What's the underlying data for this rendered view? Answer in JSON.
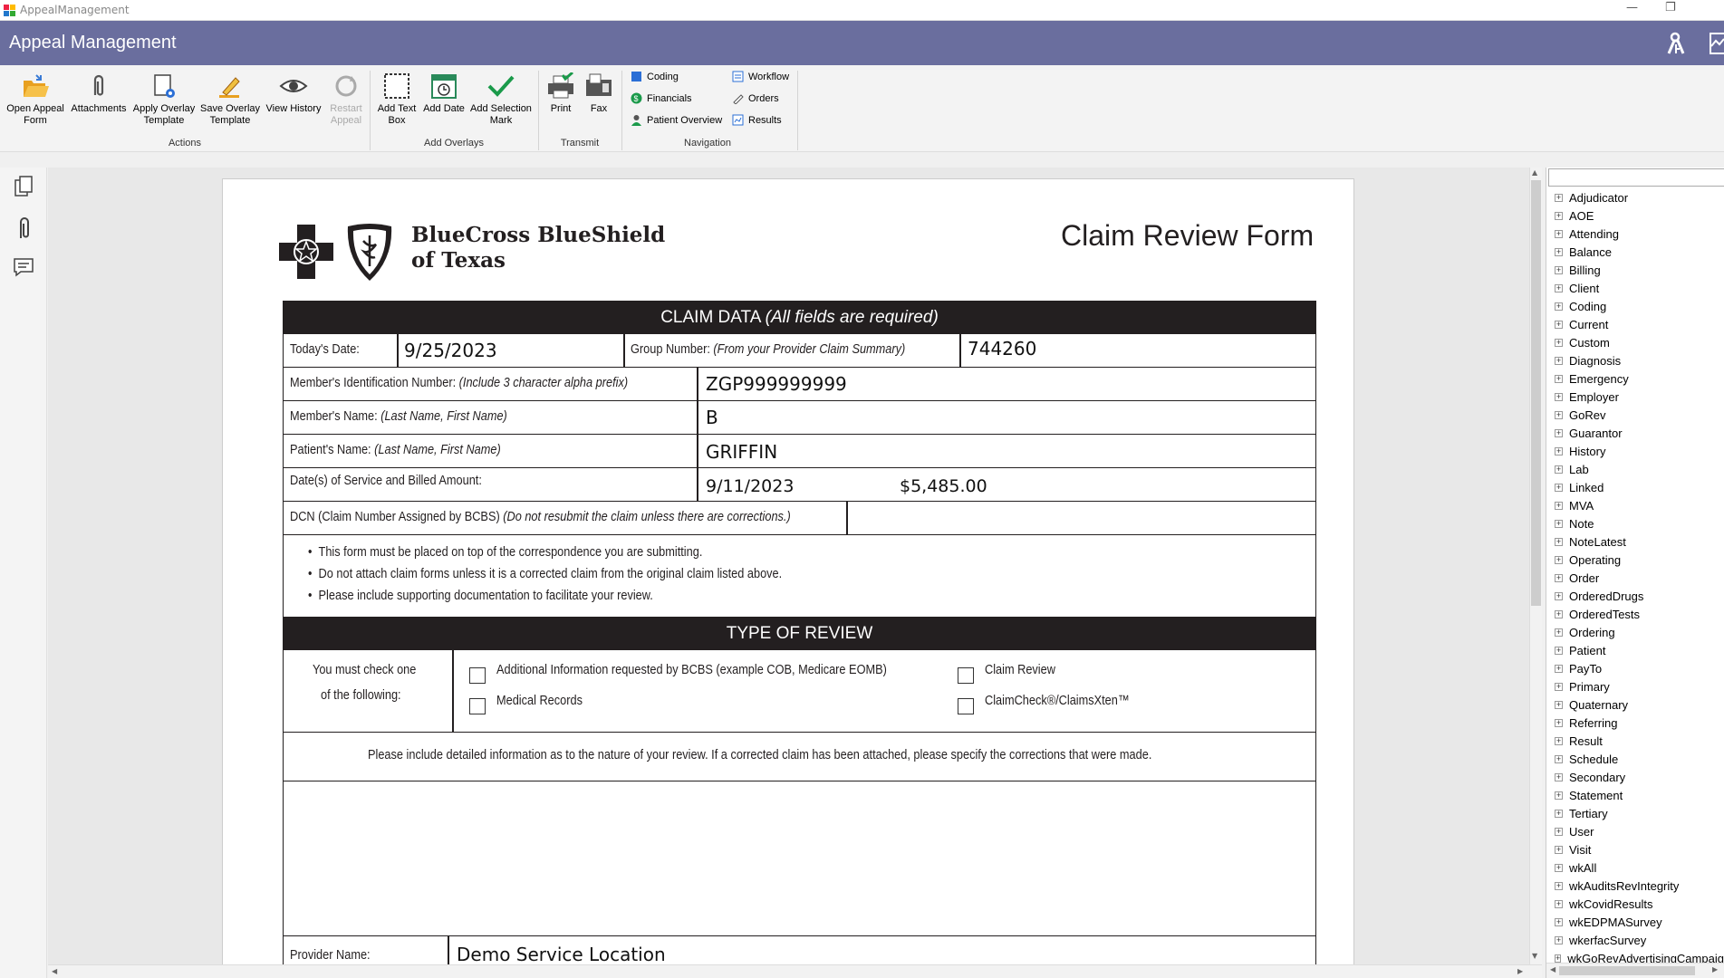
{
  "window": {
    "title": "AppealManagement"
  },
  "header": {
    "title": "Appeal Management"
  },
  "ribbon": {
    "actions": [
      {
        "label1": "Open Appeal",
        "label2": "Form"
      },
      {
        "label1": "Attachments",
        "label2": ""
      },
      {
        "label1": "Apply Overlay",
        "label2": "Template"
      },
      {
        "label1": "Save Overlay",
        "label2": "Template"
      },
      {
        "label1": "View History",
        "label2": ""
      },
      {
        "label1": "Restart",
        "label2": "Appeal"
      }
    ],
    "overlays": [
      {
        "label1": "Add Text",
        "label2": "Box"
      },
      {
        "label1": "Add Date",
        "label2": ""
      },
      {
        "label1": "Add Selection",
        "label2": "Mark"
      }
    ],
    "transmit": [
      {
        "label1": "Print"
      },
      {
        "label1": "Fax"
      }
    ],
    "navigation": [
      "Coding",
      "Financials",
      "Patient Overview",
      "Workflow",
      "Orders",
      "Results"
    ],
    "groups": {
      "actions": "Actions",
      "overlays": "Add Overlays",
      "transmit": "Transmit",
      "navigation": "Navigation"
    }
  },
  "form": {
    "logo_line1": "BlueCross BlueShield",
    "logo_line2": "of Texas",
    "title": "Claim Review Form",
    "claim_data_header": "CLAIM DATA",
    "claim_data_note": "(All fields are required)",
    "todays_date_label": "Today's Date:",
    "todays_date": "9/25/2023",
    "group_number_label": "Group Number:",
    "group_number_note": "(From your Provider Claim Summary)",
    "group_number": "744260",
    "member_id_label": "Member's Identification Number:",
    "member_id_note": "(Include 3 character alpha prefix)",
    "member_id": "ZGP999999999",
    "member_name_label": "Member's Name:",
    "member_name_note": "(Last Name, First Name)",
    "member_name": "B",
    "patient_name_label": "Patient's Name:",
    "patient_name_note": "(Last Name, First Name)",
    "patient_name": "GRIFFIN",
    "dos_label": "Date(s) of Service and Billed Amount:",
    "dos": "9/11/2023",
    "billed_amount": "$5,485.00",
    "dcn_label": "DCN (Claim Number Assigned by BCBS)",
    "dcn_note": "(Do not resubmit the claim unless there are corrections.)",
    "bullets": [
      "This form must be placed on top of the correspondence you are submitting.",
      "Do not attach claim forms unless it is a corrected claim from the original claim listed above.",
      "Please include supporting documentation to facilitate your review."
    ],
    "type_of_review_header": "TYPE OF REVIEW",
    "must_check_1": "You must check one",
    "must_check_2": "of the following:",
    "options": [
      "Additional Information requested by BCBS (example COB, Medicare EOMB)",
      "Medical Records",
      "Claim Review",
      "ClaimCheck®/ClaimsXten™"
    ],
    "details_instruction": "Please include detailed information as to the nature of your review. If a corrected claim has been attached, please specify the corrections that were made.",
    "provider_name_label": "Provider Name:",
    "provider_name": "Demo Service Location"
  },
  "tree": [
    "Adjudicator",
    "AOE",
    "Attending",
    "Balance",
    "Billing",
    "Client",
    "Coding",
    "Current",
    "Custom",
    "Diagnosis",
    "Emergency",
    "Employer",
    "GoRev",
    "Guarantor",
    "History",
    "Lab",
    "Linked",
    "MVA",
    "Note",
    "NoteLatest",
    "Operating",
    "Order",
    "OrderedDrugs",
    "OrderedTests",
    "Ordering",
    "Patient",
    "PayTo",
    "Primary",
    "Quaternary",
    "Referring",
    "Result",
    "Schedule",
    "Secondary",
    "Statement",
    "Tertiary",
    "User",
    "Visit",
    "wkAll",
    "wkAuditsRevIntegrity",
    "wkCovidResults",
    "wkEDPMASurvey",
    "wkerfacSurvey",
    "wkGoRevAdvertisingCampaign"
  ]
}
